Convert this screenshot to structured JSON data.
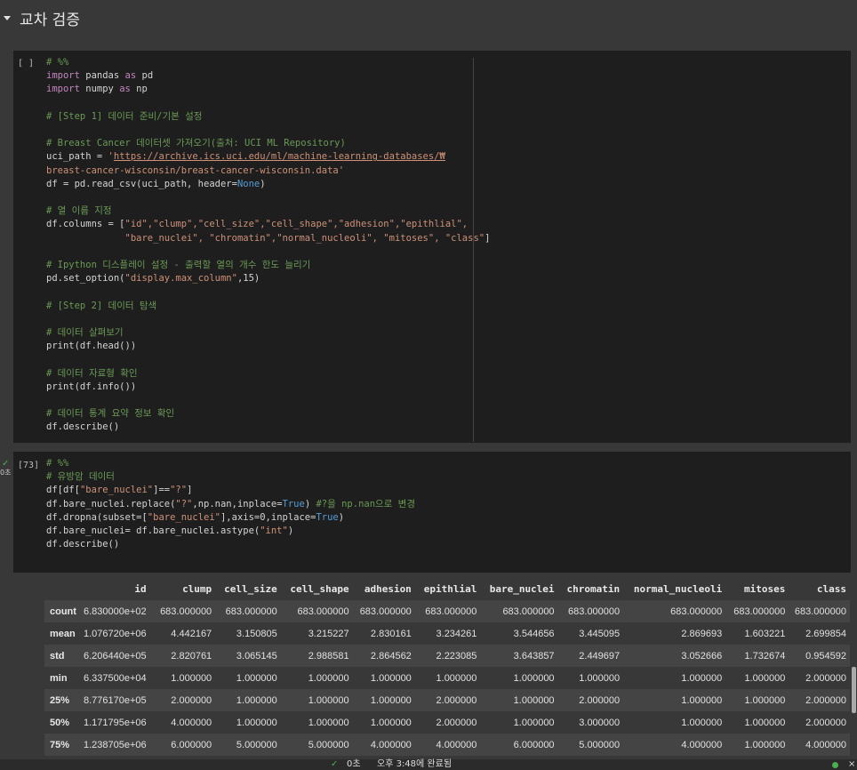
{
  "section": {
    "title": "교차 검증"
  },
  "cell1": {
    "prompt": "[ ]",
    "code_lines": [
      [
        {
          "t": "cm",
          "v": "# %%"
        }
      ],
      [
        {
          "t": "kw",
          "v": "import"
        },
        {
          "t": "",
          "v": " pandas "
        },
        {
          "t": "kw",
          "v": "as"
        },
        {
          "t": "",
          "v": " pd"
        }
      ],
      [
        {
          "t": "kw",
          "v": "import"
        },
        {
          "t": "",
          "v": " numpy "
        },
        {
          "t": "kw",
          "v": "as"
        },
        {
          "t": "",
          "v": " np"
        }
      ],
      [
        {
          "t": "",
          "v": ""
        }
      ],
      [
        {
          "t": "cm",
          "v": "# [Step 1] 데이터 준비/기본 설정"
        }
      ],
      [
        {
          "t": "",
          "v": ""
        }
      ],
      [
        {
          "t": "cm",
          "v": "# Breast Cancer 데이터셋 가져오기(출처: UCI ML Repository)"
        }
      ],
      [
        {
          "t": "",
          "v": "uci_path = "
        },
        {
          "t": "st",
          "v": "'"
        },
        {
          "t": "lk",
          "v": "https://archive.ics.uci.edu/ml/machine-learning-databases/₩"
        }
      ],
      [
        {
          "t": "st",
          "v": "breast-cancer-wisconsin/breast-cancer-wisconsin.data'"
        }
      ],
      [
        {
          "t": "",
          "v": "df = pd.read_csv(uci_path, header="
        },
        {
          "t": "nn",
          "v": "None"
        },
        {
          "t": "",
          "v": ")"
        }
      ],
      [
        {
          "t": "",
          "v": ""
        }
      ],
      [
        {
          "t": "cm",
          "v": "# 열 이름 지정"
        }
      ],
      [
        {
          "t": "",
          "v": "df.columns = ["
        },
        {
          "t": "st",
          "v": "\"id\",\"clump\",\"cell_size\",\"cell_shape\",\"adhesion\",\"epithlial\","
        }
      ],
      [
        {
          "t": "",
          "v": "              "
        },
        {
          "t": "st",
          "v": "\"bare_nuclei\", \"chromatin\",\"normal_nucleoli\", \"mitoses\", \"class\""
        },
        {
          "t": "",
          "v": "]"
        }
      ],
      [
        {
          "t": "",
          "v": ""
        }
      ],
      [
        {
          "t": "cm",
          "v": "# Ipython 디스플레이 설정 - 출력할 열의 개수 한도 늘리기"
        }
      ],
      [
        {
          "t": "",
          "v": "pd.set_option("
        },
        {
          "t": "st",
          "v": "\"display.max_column\""
        },
        {
          "t": "",
          "v": ",15)"
        }
      ],
      [
        {
          "t": "",
          "v": ""
        }
      ],
      [
        {
          "t": "cm",
          "v": "# [Step 2] 데이터 탐색"
        }
      ],
      [
        {
          "t": "",
          "v": ""
        }
      ],
      [
        {
          "t": "cm",
          "v": "# 데이터 살펴보기"
        }
      ],
      [
        {
          "t": "",
          "v": "print(df.head())"
        }
      ],
      [
        {
          "t": "",
          "v": ""
        }
      ],
      [
        {
          "t": "cm",
          "v": "# 데이터 자료형 확인"
        }
      ],
      [
        {
          "t": "",
          "v": "print(df.info())"
        }
      ],
      [
        {
          "t": "",
          "v": ""
        }
      ],
      [
        {
          "t": "cm",
          "v": "# 데이터 통계 요약 정보 확인"
        }
      ],
      [
        {
          "t": "",
          "v": "df.describe()"
        }
      ]
    ]
  },
  "cell2": {
    "prompt": "[73]",
    "status_time": "0초",
    "code_lines": [
      [
        {
          "t": "cm",
          "v": "# %%"
        }
      ],
      [
        {
          "t": "cm",
          "v": "# 유방암 데이터"
        }
      ],
      [
        {
          "t": "",
          "v": "df[df["
        },
        {
          "t": "st",
          "v": "\"bare_nuclei\""
        },
        {
          "t": "",
          "v": "]=="
        },
        {
          "t": "st",
          "v": "\"?\""
        },
        {
          "t": "",
          "v": "]"
        }
      ],
      [
        {
          "t": "",
          "v": "df.bare_nuclei.replace("
        },
        {
          "t": "st",
          "v": "\"?\""
        },
        {
          "t": "",
          "v": ",np.nan,inplace="
        },
        {
          "t": "nn",
          "v": "True"
        },
        {
          "t": "",
          "v": ") "
        },
        {
          "t": "cm",
          "v": "#?을 np.nan으로 변경"
        }
      ],
      [
        {
          "t": "",
          "v": "df.dropna(subset=["
        },
        {
          "t": "st",
          "v": "\"bare_nuclei\""
        },
        {
          "t": "",
          "v": "],axis=0,inplace="
        },
        {
          "t": "nn",
          "v": "True"
        },
        {
          "t": "",
          "v": ")"
        }
      ],
      [
        {
          "t": "",
          "v": "df.bare_nuclei= df.bare_nuclei.astype("
        },
        {
          "t": "st",
          "v": "\"int\""
        },
        {
          "t": "",
          "v": ")"
        }
      ],
      [
        {
          "t": "",
          "v": "df.describe()"
        }
      ]
    ]
  },
  "table": {
    "columns": [
      "id",
      "clump",
      "cell_size",
      "cell_shape",
      "adhesion",
      "epithlial",
      "bare_nuclei",
      "chromatin",
      "normal_nucleoli",
      "mitoses",
      "class"
    ],
    "rows": [
      {
        "label": "count",
        "values": [
          "6.830000e+02",
          "683.000000",
          "683.000000",
          "683.000000",
          "683.000000",
          "683.000000",
          "683.000000",
          "683.000000",
          "683.000000",
          "683.000000",
          "683.000000"
        ]
      },
      {
        "label": "mean",
        "values": [
          "1.076720e+06",
          "4.442167",
          "3.150805",
          "3.215227",
          "2.830161",
          "3.234261",
          "3.544656",
          "3.445095",
          "2.869693",
          "1.603221",
          "2.699854"
        ]
      },
      {
        "label": "std",
        "values": [
          "6.206440e+05",
          "2.820761",
          "3.065145",
          "2.988581",
          "2.864562",
          "2.223085",
          "3.643857",
          "2.449697",
          "3.052666",
          "1.732674",
          "0.954592"
        ]
      },
      {
        "label": "min",
        "values": [
          "6.337500e+04",
          "1.000000",
          "1.000000",
          "1.000000",
          "1.000000",
          "1.000000",
          "1.000000",
          "1.000000",
          "1.000000",
          "1.000000",
          "2.000000"
        ]
      },
      {
        "label": "25%",
        "values": [
          "8.776170e+05",
          "2.000000",
          "1.000000",
          "1.000000",
          "1.000000",
          "2.000000",
          "1.000000",
          "2.000000",
          "1.000000",
          "1.000000",
          "2.000000"
        ]
      },
      {
        "label": "50%",
        "values": [
          "1.171795e+06",
          "4.000000",
          "1.000000",
          "1.000000",
          "1.000000",
          "2.000000",
          "1.000000",
          "3.000000",
          "1.000000",
          "1.000000",
          "2.000000"
        ]
      },
      {
        "label": "75%",
        "values": [
          "1.238705e+06",
          "6.000000",
          "5.000000",
          "5.000000",
          "4.000000",
          "4.000000",
          "6.000000",
          "5.000000",
          "4.000000",
          "1.000000",
          "4.000000"
        ]
      }
    ]
  },
  "statusbar": {
    "time": "0초",
    "message": "오후 3:48에 완료됨",
    "close": "×"
  }
}
